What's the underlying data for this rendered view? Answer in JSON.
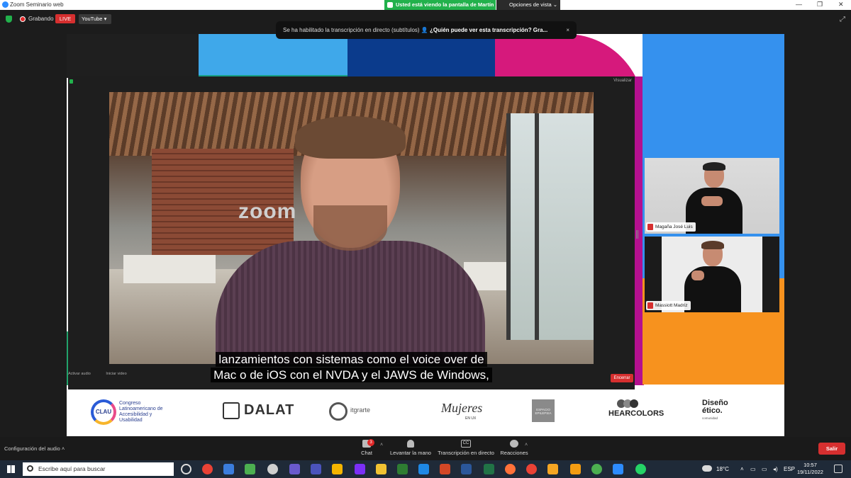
{
  "window": {
    "title": "Zoom Seminario web",
    "share_banner": "Usted está viendo la pantalla de Martín",
    "view_options": "Opciones de vista"
  },
  "top_toolbar": {
    "recording_label": "Grabando",
    "live_badge": "LIVE",
    "live_target": "YouTube"
  },
  "transcription_notice": {
    "message": "Se ha habilitado la transcripción en directo (subtítulos)",
    "link": "¿Quién puede ver esta transcripción? Gra...",
    "close": "×"
  },
  "main_video": {
    "corner_label": "Visualizar",
    "background_sign": "zoom",
    "subtitle_lines": [
      "lanzamientos con sistemas como el voice over de",
      "Mac o de iOS con el NVDA y el JAWS de Windows,"
    ],
    "mini_controls": [
      "Activar audio",
      "Iniciar video"
    ],
    "end_button": "Encerrar"
  },
  "interpreters": [
    {
      "name": "Magaña José Luis"
    },
    {
      "name": "Massiott Madriz"
    }
  ],
  "sponsors": {
    "clau_mark": "CLAU",
    "clau_text": [
      "Congreso",
      "Latinoamericano de",
      "Accesibilidad y",
      "Usabilidad"
    ],
    "dalat": "DALAT",
    "itgrarte": "itgrarte",
    "mujeres": "Mujeres",
    "mujeres_sub": "EN UX",
    "epilepsia": "ESPACIO EPILEPSIA",
    "hearcolors": "HEARCOLORS",
    "diseno": [
      "Diseño",
      "ético."
    ],
    "diseno_sub": "comunidad"
  },
  "bottom_toolbar": {
    "audio_config": "Configuración del audio",
    "chat_label": "Chat",
    "chat_badge": "3",
    "raise_hand": "Levantar la mano",
    "transcription": "Transcripción en directo",
    "cc_icon": "CC",
    "reactions": "Reacciones",
    "leave": "Salir"
  },
  "taskbar": {
    "search_placeholder": "Escribe aquí para buscar",
    "weather": "18°C",
    "language": "ESP",
    "time": "10:57",
    "date": "19/11/2022"
  },
  "colors": {
    "zoom_blue": "#2d8cff",
    "live_red": "#d62f2f",
    "share_green": "#22b14c",
    "canvas_magenta": "#d6197c",
    "canvas_blue": "#3591ee",
    "canvas_orange": "#f7921e"
  }
}
